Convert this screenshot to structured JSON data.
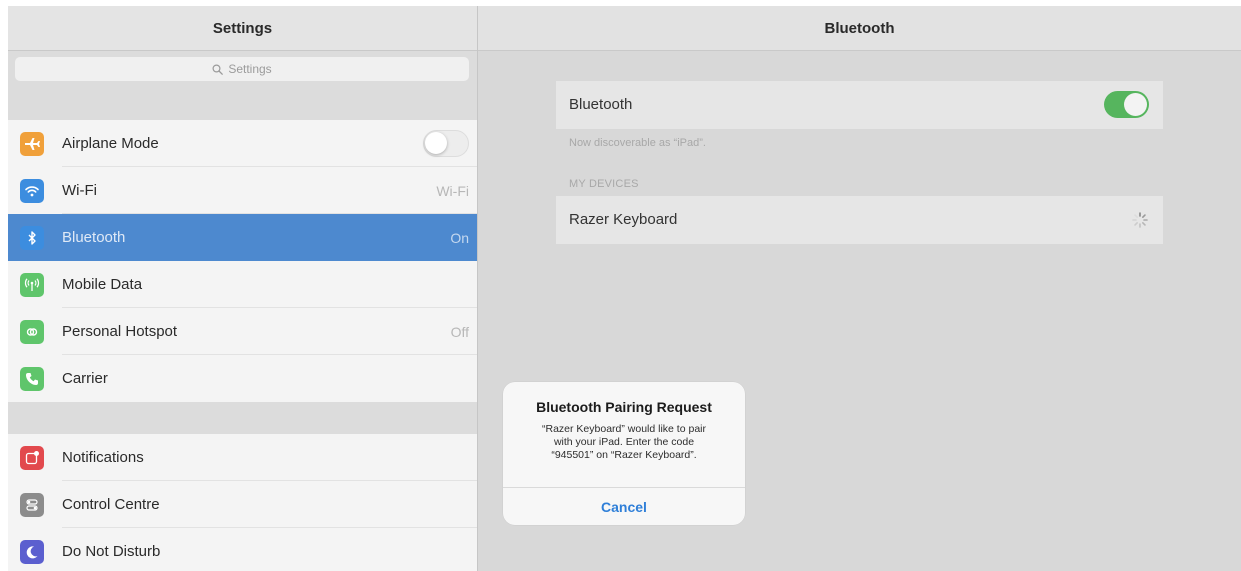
{
  "master": {
    "title": "Settings",
    "search": {
      "placeholder": "Settings",
      "icon": "search-icon"
    },
    "groups": [
      [
        {
          "label": "Airplane Mode",
          "icon": "airplane-icon",
          "color": "#f0a03a",
          "accessory": "toggle",
          "toggle_on": false
        },
        {
          "label": "Wi-Fi",
          "icon": "wifi-icon",
          "color": "#3c8ddf",
          "value": "Wi-Fi"
        },
        {
          "label": "Bluetooth",
          "icon": "bluetooth-icon",
          "color": "#3c8ddf",
          "value": "On",
          "selected": true
        },
        {
          "label": "Mobile Data",
          "icon": "antenna-icon",
          "color": "#5fc56b"
        },
        {
          "label": "Personal Hotspot",
          "icon": "hotspot-icon",
          "color": "#5fc56b",
          "value": "Off"
        },
        {
          "label": "Carrier",
          "icon": "phone-icon",
          "color": "#5fc56b"
        }
      ],
      [
        {
          "label": "Notifications",
          "icon": "notifications-icon",
          "color": "#e2494d"
        },
        {
          "label": "Control Centre",
          "icon": "control-centre-icon",
          "color": "#8c8c8c"
        },
        {
          "label": "Do Not Disturb",
          "icon": "moon-icon",
          "color": "#5b5fcf"
        }
      ]
    ]
  },
  "detail": {
    "title": "Bluetooth",
    "bluetooth_label": "Bluetooth",
    "bluetooth_on": true,
    "accent_green": "#56b55e",
    "discoverable_text": "Now discoverable as “iPad”.",
    "my_devices_header": "MY DEVICES",
    "device_name": "Razer Keyboard",
    "device_status_icon": "spinner-icon"
  },
  "alert": {
    "title": "Bluetooth Pairing Request",
    "message_lines": [
      "“Razer Keyboard” would like to pair",
      "with your iPad. Enter the code",
      "“945501” on “Razer Keyboard”."
    ],
    "cancel_label": "Cancel",
    "button_color": "#2f7fd8"
  }
}
